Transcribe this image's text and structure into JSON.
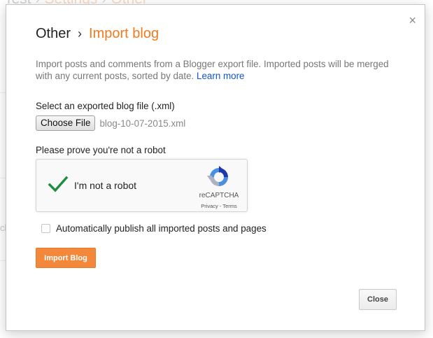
{
  "background": {
    "breadcrumb": [
      "Test",
      "Settings",
      "Other"
    ],
    "fragment": "cl"
  },
  "dialog": {
    "title": {
      "parent": "Other",
      "chevron": "›",
      "current": "Import blog"
    },
    "close_glyph": "×",
    "description": "Import posts and comments from a Blogger export file. Imported posts will be merged with any current posts, sorted by date.",
    "learn_more": "Learn more",
    "file_section": {
      "label": "Select an exported blog file (.xml)",
      "choose_button": "Choose File",
      "file_name": "blog-10-07-2015.xml"
    },
    "robot_section": {
      "label": "Please prove you're not a robot",
      "captcha_label": "I'm not a robot",
      "captcha_brand": "reCAPTCHA",
      "captcha_legal": "Privacy - Terms",
      "checked": true
    },
    "auto_publish": {
      "label": "Automatically publish all imported posts and pages",
      "checked": false
    },
    "import_button": "Import Blog",
    "close_button": "Close"
  },
  "colors": {
    "accent": "#f07b1e",
    "import_button": "#f3883b",
    "link": "#1155cc",
    "check": "#1e8e3e"
  },
  "icons": {
    "close": "close-icon",
    "check": "checkmark-icon",
    "recaptcha": "recaptcha-logo-icon"
  }
}
